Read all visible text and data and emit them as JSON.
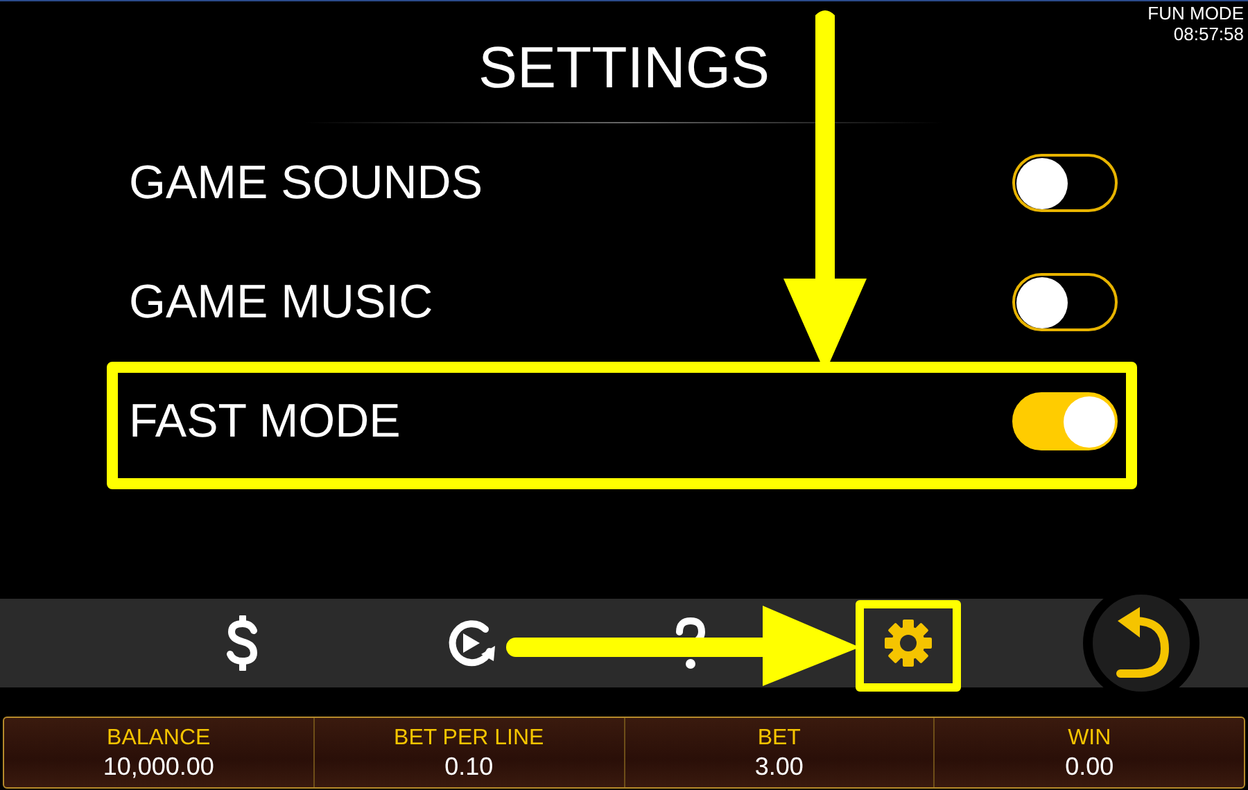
{
  "status": {
    "mode": "FUN MODE",
    "time": "08:57:58"
  },
  "title": "SETTINGS",
  "settings": [
    {
      "label": "GAME SOUNDS",
      "on": false,
      "highlighted": false
    },
    {
      "label": "GAME MUSIC",
      "on": false,
      "highlighted": false
    },
    {
      "label": "FAST MODE",
      "on": true,
      "highlighted": true
    }
  ],
  "toolbar": [
    {
      "kind": "dollar",
      "highlighted": false
    },
    {
      "kind": "replay",
      "highlighted": false
    },
    {
      "kind": "help",
      "highlighted": false
    },
    {
      "kind": "settings",
      "highlighted": true
    },
    {
      "kind": "back",
      "highlighted": false
    }
  ],
  "footer": [
    {
      "label": "BALANCE",
      "value": "10,000.00"
    },
    {
      "label": "BET PER LINE",
      "value": "0.10"
    },
    {
      "label": "BET",
      "value": "3.00"
    },
    {
      "label": "WIN",
      "value": "0.00"
    }
  ]
}
